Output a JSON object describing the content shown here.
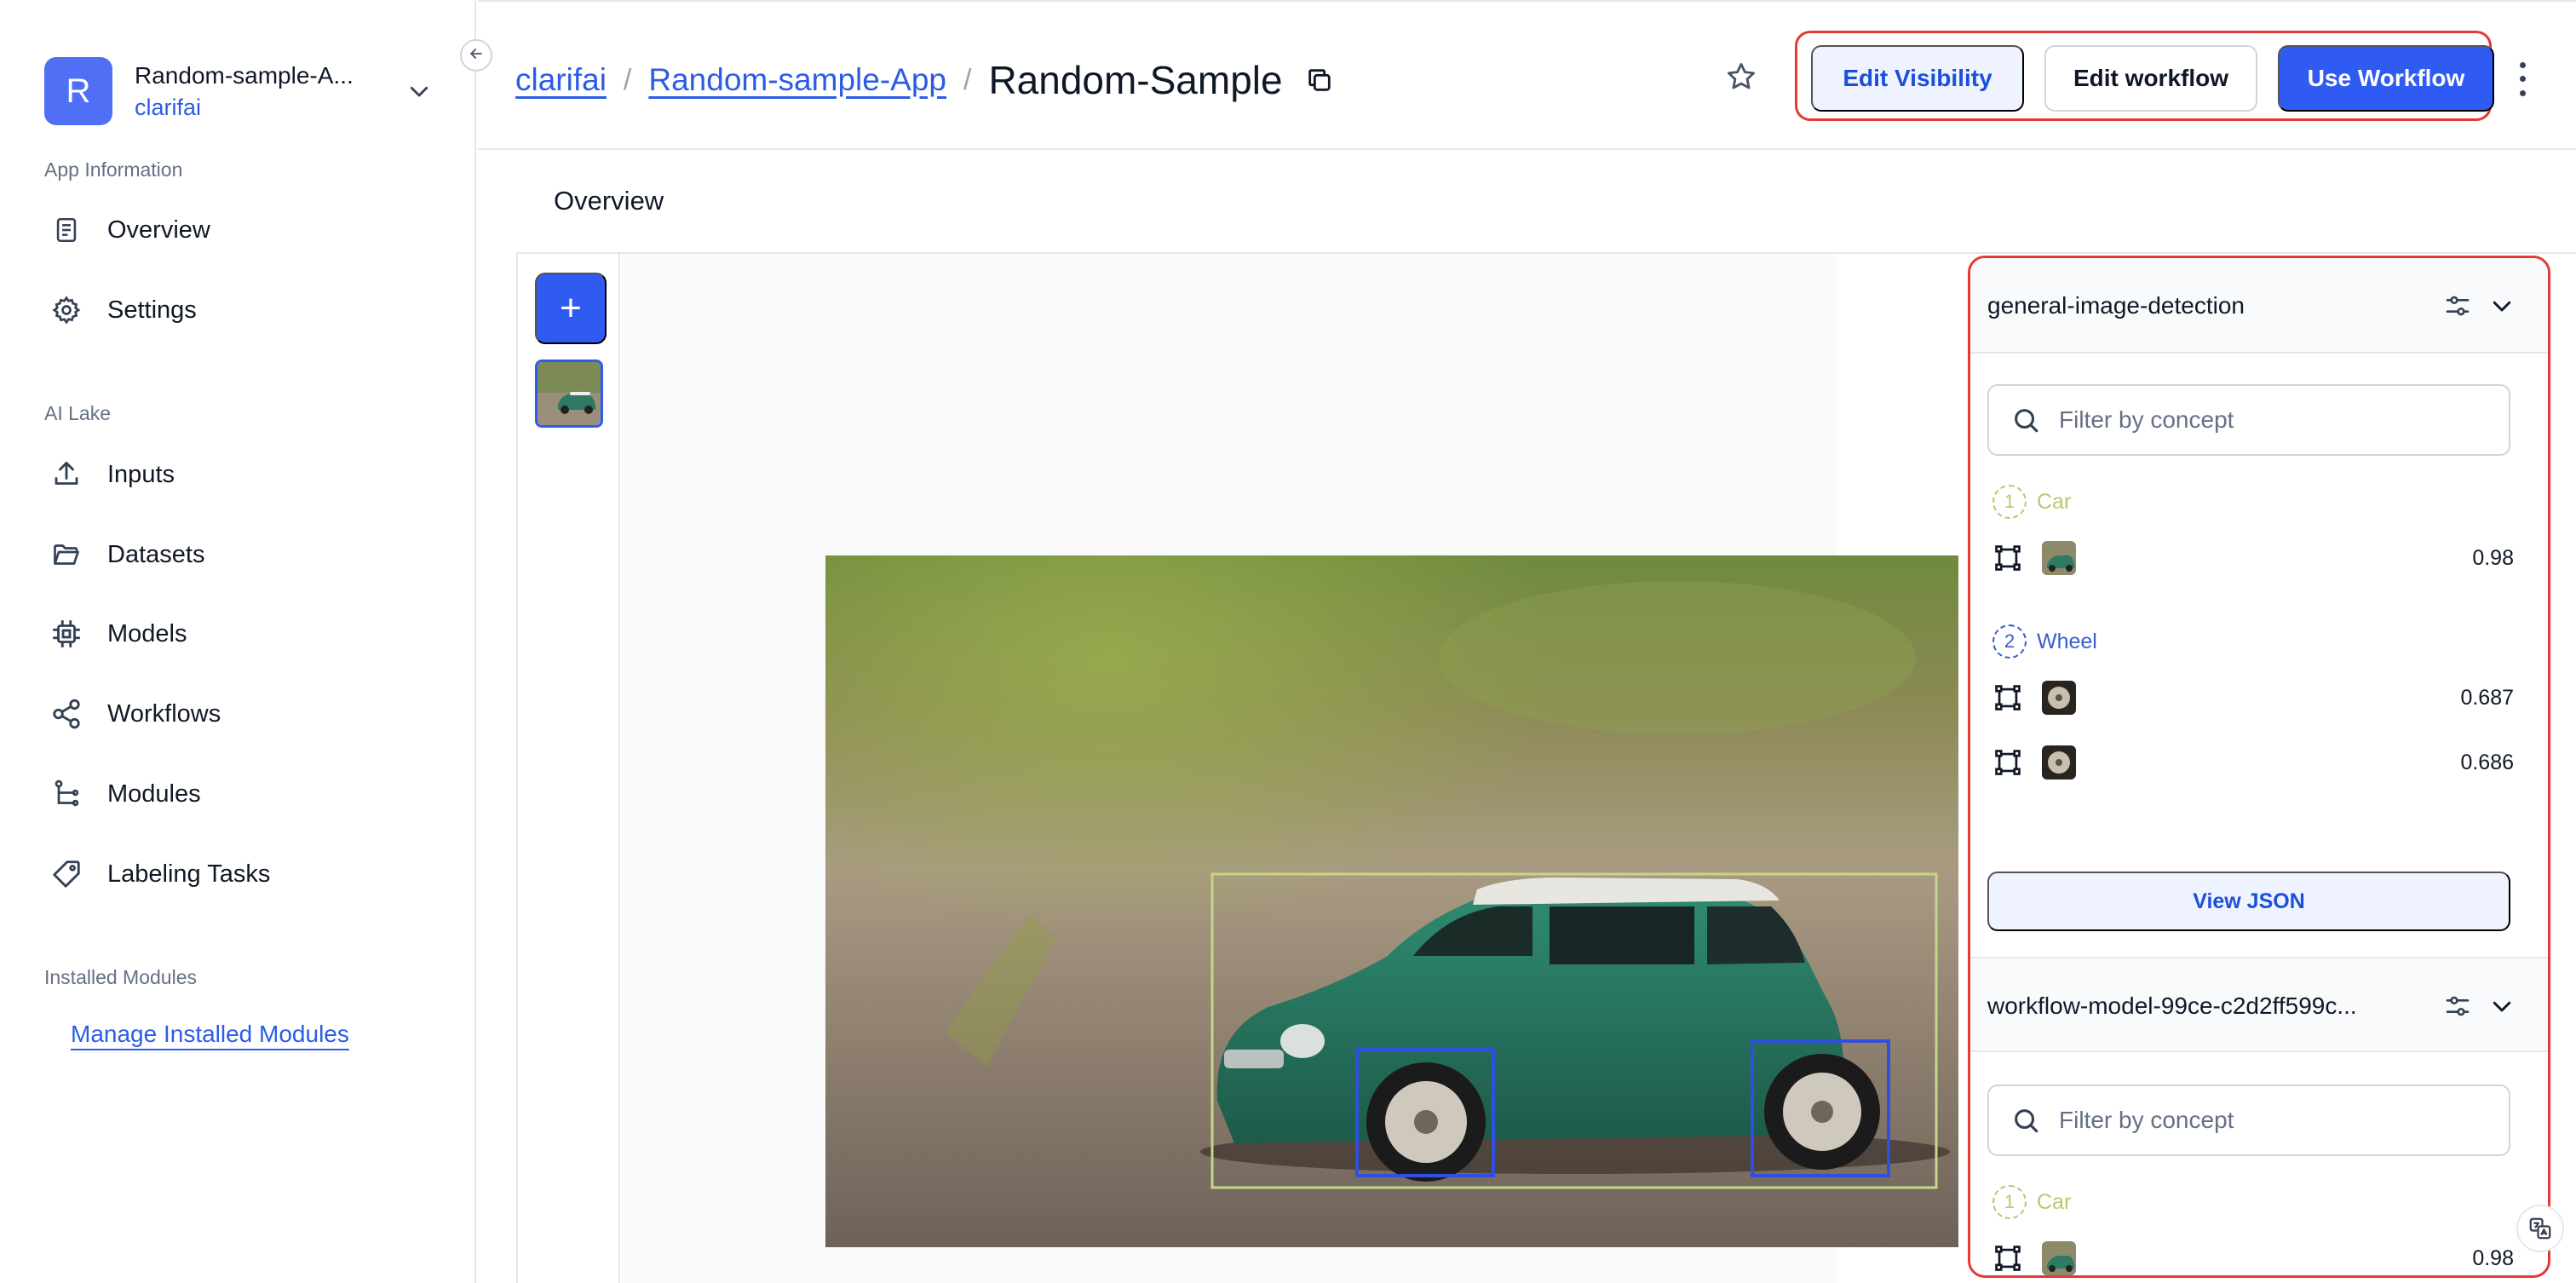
{
  "sidebar": {
    "app_initial": "R",
    "app_name": "Random-sample-A...",
    "app_org": "clarifai",
    "sections": {
      "app_information": "App Information",
      "ai_lake": "AI Lake",
      "installed_modules": "Installed Modules"
    },
    "items": [
      {
        "label": "Overview",
        "icon": "document-icon"
      },
      {
        "label": "Settings",
        "icon": "gear-icon"
      },
      {
        "label": "Inputs",
        "icon": "upload-icon"
      },
      {
        "label": "Datasets",
        "icon": "folder-icon"
      },
      {
        "label": "Models",
        "icon": "chip-icon"
      },
      {
        "label": "Workflows",
        "icon": "share-nodes-icon"
      },
      {
        "label": "Modules",
        "icon": "module-tree-icon"
      },
      {
        "label": "Labeling Tasks",
        "icon": "tag-icon"
      }
    ],
    "manage_link": "Manage Installed Modules"
  },
  "header": {
    "breadcrumb": [
      "clarifai",
      "Random-sample-App"
    ],
    "separator": "/",
    "current": "Random-Sample",
    "buttons": {
      "edit_visibility": "Edit Visibility",
      "edit_workflow": "Edit workflow",
      "use_workflow": "Use Workflow"
    }
  },
  "tabs": {
    "overview": "Overview"
  },
  "workspace": {
    "add_label": "+"
  },
  "panel": {
    "models": [
      {
        "name": "general-image-detection",
        "filter_placeholder": "Filter by concept",
        "concepts": [
          {
            "index": "1",
            "name": "Car",
            "color": "#b7c96b",
            "regions": [
              "0.98"
            ]
          },
          {
            "index": "2",
            "name": "Wheel",
            "color": "#3a5ccc",
            "regions": [
              "0.687",
              "0.686"
            ]
          }
        ],
        "view_json": "View JSON"
      },
      {
        "name": "workflow-model-99ce-c2d2ff599c...",
        "filter_placeholder": "Filter by concept",
        "concepts": [
          {
            "index": "1",
            "name": "Car",
            "color": "#b7c96b",
            "regions": [
              "0.98"
            ]
          }
        ]
      }
    ]
  },
  "colors": {
    "primary": "#2f5bf2",
    "link": "#2b5ce6",
    "highlight_border": "#e53935",
    "car_box": "#c5d68a",
    "wheel_box": "#2f4fe0"
  }
}
